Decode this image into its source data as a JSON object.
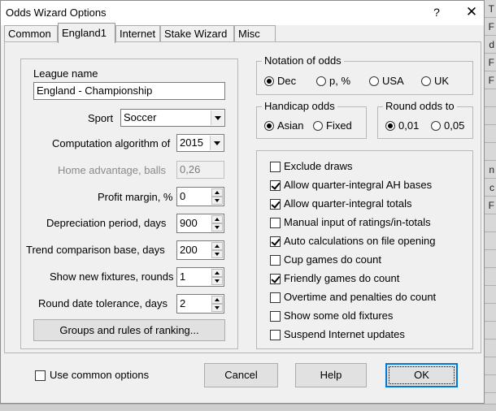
{
  "window": {
    "title": "Odds Wizard Options",
    "help": "?",
    "close": "✕"
  },
  "background_cells": [
    "T",
    "F",
    "d",
    "F",
    "F",
    "",
    "",
    "",
    "",
    "n",
    "c",
    "F",
    "",
    "",
    "",
    "",
    "",
    "",
    "",
    "",
    "",
    "",
    ""
  ],
  "tabs": [
    {
      "label": "Common",
      "active": false
    },
    {
      "label": "England1",
      "active": true
    },
    {
      "label": "Internet",
      "active": false
    },
    {
      "label": "Stake Wizard",
      "active": false
    },
    {
      "label": "Misc",
      "active": false
    }
  ],
  "league": {
    "name_label": "League name",
    "name_value": "England - Championship",
    "sport_label": "Sport",
    "sport_value": "Soccer",
    "algorithm_label": "Computation algorithm of",
    "algorithm_value": "2015",
    "home_adv_label": "Home advantage, balls",
    "home_adv_value": "0,26",
    "profit_label": "Profit margin, %",
    "profit_value": "0",
    "depreciation_label": "Depreciation period, days",
    "depreciation_value": "900",
    "trend_label": "Trend comparison base, days",
    "trend_value": "200",
    "fixtures_label": "Show new fixtures, rounds",
    "fixtures_value": "1",
    "tolerance_label": "Round date tolerance, days",
    "tolerance_value": "2",
    "groups_button": "Groups and rules of ranking..."
  },
  "notation": {
    "title": "Notation of odds",
    "options": [
      {
        "label": "Dec",
        "selected": true
      },
      {
        "label": "p, %",
        "selected": false
      },
      {
        "label": "USA",
        "selected": false
      },
      {
        "label": "UK",
        "selected": false
      }
    ]
  },
  "handicap": {
    "title": "Handicap odds",
    "options": [
      {
        "label": "Asian",
        "selected": true
      },
      {
        "label": "Fixed",
        "selected": false
      }
    ]
  },
  "round_odds": {
    "title": "Round odds to",
    "options": [
      {
        "label": "0,01",
        "selected": true
      },
      {
        "label": "0,05",
        "selected": false
      }
    ]
  },
  "checkboxes": [
    {
      "label": "Exclude draws",
      "checked": false
    },
    {
      "label": "Allow quarter-integral AH bases",
      "checked": true
    },
    {
      "label": "Allow quarter-integral totals",
      "checked": true
    },
    {
      "label": "Manual input of ratings/in-totals",
      "checked": false
    },
    {
      "label": "Auto calculations on file opening",
      "checked": true
    },
    {
      "label": "Cup games do count",
      "checked": false
    },
    {
      "label": "Friendly games do count",
      "checked": true
    },
    {
      "label": "Overtime and penalties do count",
      "checked": false
    },
    {
      "label": "Show some old fixtures",
      "checked": false
    },
    {
      "label": "Suspend Internet updates",
      "checked": false
    }
  ],
  "footer": {
    "use_common_label": "Use common options",
    "use_common_checked": false,
    "cancel": "Cancel",
    "help": "Help",
    "ok": "OK"
  }
}
